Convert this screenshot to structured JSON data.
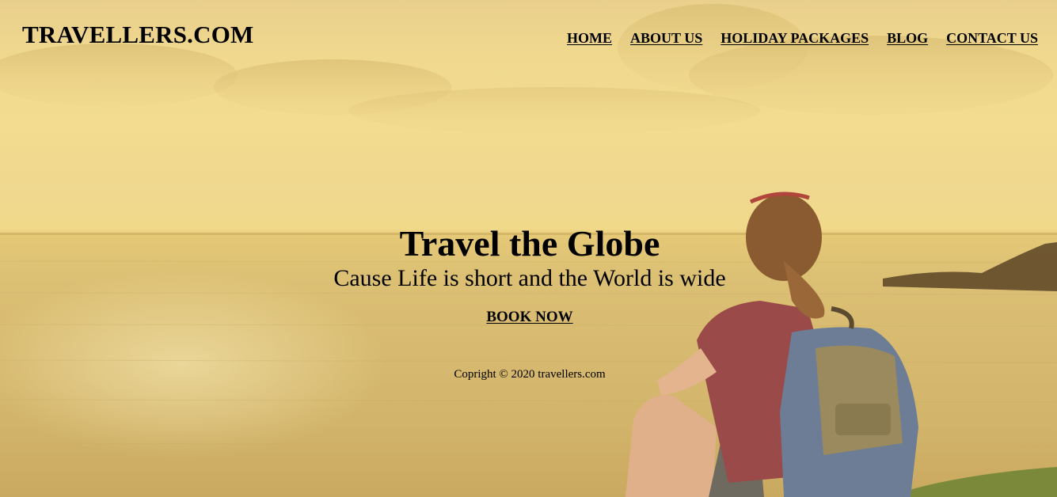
{
  "brand": {
    "name": "TRAVELLERS.COM"
  },
  "nav": {
    "items": [
      {
        "label": "HOME"
      },
      {
        "label": "ABOUT US"
      },
      {
        "label": "HOLIDAY PACKAGES"
      },
      {
        "label": "BLOG"
      },
      {
        "label": "CONTACT US"
      }
    ]
  },
  "hero": {
    "title": "Travel the Globe",
    "subtitle": "Cause Life is short and the World is wide",
    "cta_label": "BOOK NOW",
    "image_subject": "traveller with backpack sitting by the sea at sunset"
  },
  "footer": {
    "copyright": "Copright © 2020 travellers.com"
  },
  "colors": {
    "sky": "#f3dc8f",
    "sea": "#d7ba70",
    "text": "#000000"
  }
}
